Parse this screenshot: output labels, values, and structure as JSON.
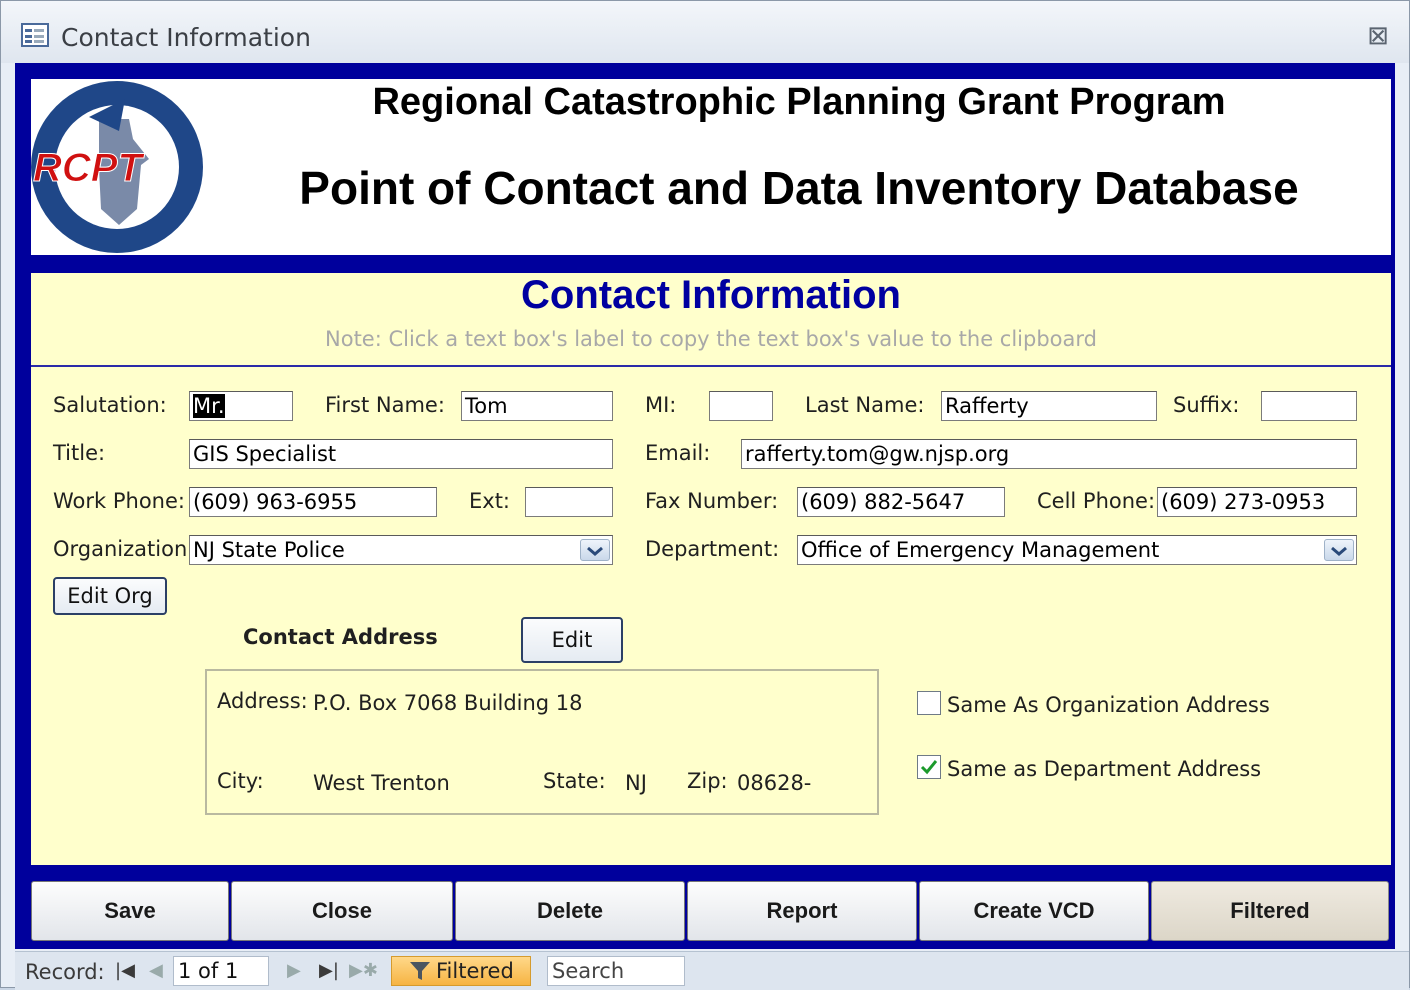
{
  "window": {
    "title": "Contact Information",
    "close_glyph": "⊠"
  },
  "header": {
    "program": "Regional Catastrophic Planning Grant Program",
    "database": "Point of Contact and Data Inventory Database",
    "logo_text": "RCPT"
  },
  "form": {
    "title": "Contact Information",
    "note": "Note: Click a text box's label to copy the text box's value to the clipboard"
  },
  "fields": {
    "salutation": {
      "label": "Salutation:",
      "value": "Mr."
    },
    "first_name": {
      "label": "First Name:",
      "value": "Tom"
    },
    "mi": {
      "label": "MI:",
      "value": ""
    },
    "last_name": {
      "label": "Last Name:",
      "value": "Rafferty"
    },
    "suffix": {
      "label": "Suffix:",
      "value": ""
    },
    "title": {
      "label": "Title:",
      "value": "GIS Specialist"
    },
    "email": {
      "label": "Email:",
      "value": "rafferty.tom@gw.njsp.org"
    },
    "work_phone": {
      "label": "Work Phone:",
      "value": "(609) 963-6955"
    },
    "ext": {
      "label": "Ext:",
      "value": ""
    },
    "fax": {
      "label": "Fax Number:",
      "value": "(609) 882-5647"
    },
    "cell": {
      "label": "Cell Phone:",
      "value": "(609) 273-0953"
    },
    "organization": {
      "label": "Organization:",
      "value": "NJ State Police"
    },
    "department": {
      "label": "Department:",
      "value": "Office of Emergency Management"
    }
  },
  "buttons": {
    "edit_org": "Edit Org",
    "edit": "Edit"
  },
  "address": {
    "section_label": "Contact Address",
    "address_label": "Address:",
    "address_value": "P.O. Box 7068  Building 18",
    "city_label": "City:",
    "city_value": "West Trenton",
    "state_label": "State:",
    "state_value": "NJ",
    "zip_label": "Zip:",
    "zip_value": "08628-"
  },
  "checkboxes": {
    "same_org": {
      "label": "Same As Organization Address",
      "checked": false
    },
    "same_dept": {
      "label": "Same as Department Address",
      "checked": true
    }
  },
  "commands": [
    "Save",
    "Close",
    "Delete",
    "Report",
    "Create VCD",
    "Filtered"
  ],
  "navigation": {
    "record_label": "Record:",
    "position": "1 of 1",
    "filter_label": "Filtered",
    "search_label": "Search"
  },
  "colors": {
    "frame": "#00009c",
    "form_bg": "#ffffcc",
    "title_blue": "#0000a0",
    "filter_orange": "#f6b443"
  }
}
